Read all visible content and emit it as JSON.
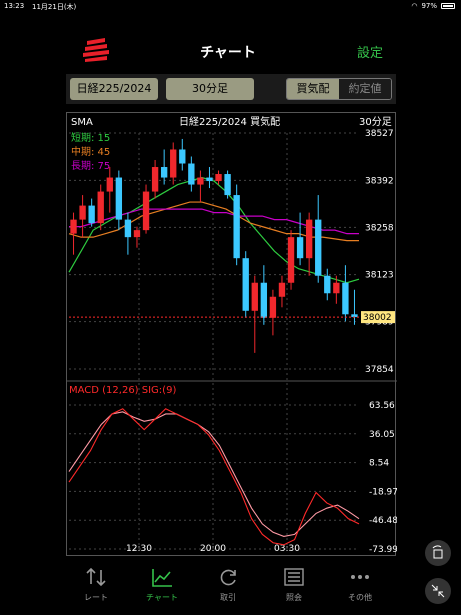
{
  "status": {
    "time": "13:23",
    "date": "11月21日(木)",
    "battery": "97%"
  },
  "app": {
    "title": "チャート",
    "settings_label": "設定"
  },
  "toolbar": {
    "symbol": "日経225/2024",
    "interval": "30分足",
    "mode_on": "買気配",
    "mode_off": "約定値"
  },
  "chart": {
    "header_left": "SMA",
    "header_center": "日経225/2024  買気配",
    "header_right": "30分足",
    "legend": [
      {
        "label": "短期: 15",
        "color": "#2ecc40"
      },
      {
        "label": "中期: 45",
        "color": "#e67e22"
      },
      {
        "label": "長期: 75",
        "color": "#c800c8"
      }
    ],
    "price_ticks": [
      "38527",
      "38392",
      "38258",
      "38123",
      "37989",
      "37854"
    ],
    "current_price": "38002",
    "macd_title": "MACD (12,26) SIG:(9)",
    "macd_ticks": [
      "63.56",
      "36.05",
      "8.54",
      "-18.97",
      "-46.48",
      "-73.99"
    ],
    "time_ticks": [
      "12:30",
      "20:00",
      "03:30"
    ],
    "colors": {
      "up": "#f0282d",
      "down": "#3cc8ff",
      "macd": "#ff2a2a",
      "signal": "#ff9aa5"
    }
  },
  "chart_data": {
    "type": "candlestick",
    "price_range": [
      37854,
      38527
    ],
    "candles": [
      [
        38240,
        38300,
        38180,
        38280
      ],
      [
        38280,
        38350,
        38230,
        38320
      ],
      [
        38320,
        38340,
        38260,
        38270
      ],
      [
        38270,
        38380,
        38250,
        38360
      ],
      [
        38360,
        38430,
        38300,
        38400
      ],
      [
        38400,
        38420,
        38250,
        38280
      ],
      [
        38280,
        38300,
        38180,
        38230
      ],
      [
        38230,
        38260,
        38200,
        38250
      ],
      [
        38250,
        38380,
        38240,
        38360
      ],
      [
        38360,
        38450,
        38340,
        38430
      ],
      [
        38430,
        38480,
        38380,
        38400
      ],
      [
        38400,
        38500,
        38380,
        38480
      ],
      [
        38480,
        38510,
        38420,
        38440
      ],
      [
        38440,
        38460,
        38360,
        38380
      ],
      [
        38380,
        38420,
        38330,
        38400
      ],
      [
        38400,
        38430,
        38370,
        38390
      ],
      [
        38390,
        38420,
        38380,
        38410
      ],
      [
        38410,
        38420,
        38340,
        38350
      ],
      [
        38350,
        38380,
        38150,
        38170
      ],
      [
        38170,
        38190,
        38000,
        38020
      ],
      [
        38020,
        38120,
        37900,
        38100
      ],
      [
        38100,
        38150,
        37980,
        38000
      ],
      [
        38000,
        38080,
        37950,
        38060
      ],
      [
        38060,
        38120,
        38030,
        38100
      ],
      [
        38100,
        38250,
        38080,
        38230
      ],
      [
        38230,
        38300,
        38150,
        38170
      ],
      [
        38170,
        38300,
        38120,
        38280
      ],
      [
        38280,
        38350,
        38100,
        38120
      ],
      [
        38120,
        38140,
        38050,
        38070
      ],
      [
        38070,
        38120,
        38040,
        38100
      ],
      [
        38100,
        38150,
        37990,
        38010
      ],
      [
        38010,
        38080,
        37980,
        38002
      ]
    ],
    "series": [
      {
        "name": "短期: 15",
        "color": "#2ecc40",
        "values": [
          38130,
          38190,
          38250,
          38270,
          38290,
          38300,
          38320,
          38340,
          38360,
          38380,
          38390,
          38400,
          38390,
          38360,
          38320,
          38270,
          38230,
          38190,
          38160,
          38140,
          38130,
          38120,
          38110,
          38100,
          38110
        ]
      },
      {
        "name": "中期: 45",
        "color": "#e67e22",
        "values": [
          38240,
          38230,
          38230,
          38240,
          38250,
          38270,
          38290,
          38300,
          38310,
          38320,
          38330,
          38330,
          38320,
          38310,
          38290,
          38270,
          38260,
          38250,
          38240,
          38240,
          38230,
          38230,
          38225,
          38220,
          38220
        ]
      },
      {
        "name": "長期: 75",
        "color": "#c800c8",
        "values": [
          38260,
          38260,
          38270,
          38280,
          38290,
          38300,
          38310,
          38310,
          38310,
          38310,
          38310,
          38310,
          38300,
          38300,
          38290,
          38290,
          38290,
          38280,
          38280,
          38270,
          38260,
          38250,
          38250,
          38240,
          38240
        ]
      }
    ],
    "macd": {
      "range": [
        -73.99,
        63.56
      ],
      "macd": [
        -10,
        5,
        20,
        40,
        55,
        60,
        50,
        40,
        50,
        60,
        55,
        50,
        45,
        35,
        20,
        0,
        -20,
        -45,
        -60,
        -68,
        -70,
        -65,
        -40,
        -20,
        -30,
        -35,
        -45,
        -50
      ],
      "signal": [
        0,
        15,
        30,
        45,
        55,
        57,
        52,
        48,
        50,
        55,
        55,
        50,
        45,
        38,
        25,
        5,
        -15,
        -35,
        -50,
        -58,
        -62,
        -60,
        -50,
        -40,
        -35,
        -32,
        -38,
        -45
      ]
    }
  },
  "tabs": [
    {
      "label": "レート",
      "icon": "arrows-updown-icon"
    },
    {
      "label": "チャート",
      "icon": "line-chart-icon"
    },
    {
      "label": "取引",
      "icon": "refresh-icon"
    },
    {
      "label": "照会",
      "icon": "list-icon"
    },
    {
      "label": "その他",
      "icon": "more-dots-icon"
    }
  ]
}
